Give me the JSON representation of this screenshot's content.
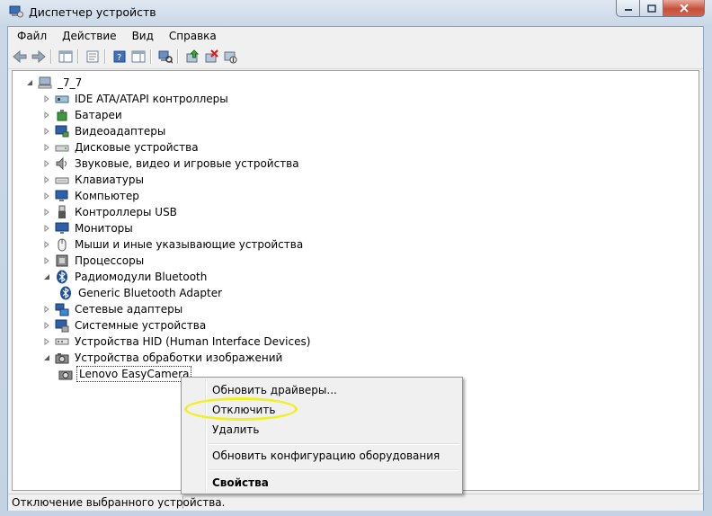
{
  "window": {
    "title": "Диспетчер устройств"
  },
  "menu": [
    "Файл",
    "Действие",
    "Вид",
    "Справка"
  ],
  "tree": {
    "root": "_7_7",
    "categories": [
      {
        "label": "IDE ATA/ATAPI контроллеры",
        "icon": "ide-controller-icon"
      },
      {
        "label": "Батареи",
        "icon": "battery-icon"
      },
      {
        "label": "Видеоадаптеры",
        "icon": "display-adapter-icon"
      },
      {
        "label": "Дисковые устройства",
        "icon": "disk-drive-icon"
      },
      {
        "label": "Звуковые, видео и игровые устройства",
        "icon": "speaker-icon"
      },
      {
        "label": "Клавиатуры",
        "icon": "keyboard-icon"
      },
      {
        "label": "Компьютер",
        "icon": "computer-icon"
      },
      {
        "label": "Контроллеры USB",
        "icon": "usb-icon"
      },
      {
        "label": "Мониторы",
        "icon": "monitor-icon"
      },
      {
        "label": "Мыши и иные указывающие устройства",
        "icon": "mouse-icon"
      },
      {
        "label": "Процессоры",
        "icon": "processor-icon"
      },
      {
        "label": "Радиомодули Bluetooth",
        "icon": "bluetooth-icon",
        "expanded": true,
        "children": [
          "Generic Bluetooth Adapter"
        ]
      },
      {
        "label": "Сетевые адаптеры",
        "icon": "network-adapter-icon"
      },
      {
        "label": "Системные устройства",
        "icon": "system-device-icon"
      },
      {
        "label": "Устройства HID (Human Interface Devices)",
        "icon": "hid-icon"
      },
      {
        "label": "Устройства обработки изображений",
        "icon": "imaging-device-icon",
        "expanded": true,
        "children": [
          "Lenovo EasyCamera"
        ]
      }
    ]
  },
  "context_menu": {
    "items": [
      "Обновить драйверы...",
      "Отключить",
      "Удалить",
      "Обновить конфигурацию оборудования",
      "Свойства"
    ]
  },
  "status_bar": {
    "text": "Отключение выбранного устройства."
  },
  "colors": {
    "highlight": "#f1ef2a",
    "title_bar": "#c9d7e6"
  }
}
